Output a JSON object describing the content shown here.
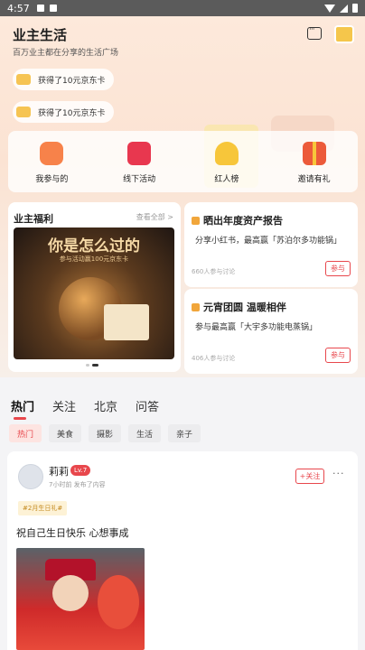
{
  "status": {
    "time": "4:57"
  },
  "header": {
    "title": "业主生活",
    "subtitle": "百万业主都在分享的生活广场"
  },
  "notifications": [
    {
      "text": "获得了10元京东卡"
    },
    {
      "text": "获得了10元京东卡"
    }
  ],
  "categories": [
    {
      "label": "我参与的",
      "icon": "chat-bubble-icon"
    },
    {
      "label": "线下活动",
      "icon": "flag-icon"
    },
    {
      "label": "红人榜",
      "icon": "crown-icon"
    },
    {
      "label": "邀请有礼",
      "icon": "gift-icon"
    }
  ],
  "welfare": {
    "title": "业主福利",
    "more": "查看全部 >",
    "banner_title": "你是怎么过的",
    "banner_sub": "参与活动赢100元京东卡"
  },
  "activities": [
    {
      "title": "晒出年度资产报告",
      "desc": "分享小红书，最高赢「苏泊尔多功能锅」",
      "count": "660人参与讨论",
      "btn": "参与"
    },
    {
      "title": "元宵团圆 温暖相伴",
      "desc": "参与最高赢「大宇多功能电蒸锅」",
      "count": "406人参与讨论",
      "btn": "参与"
    }
  ],
  "tabs": [
    "热门",
    "关注",
    "北京",
    "问答"
  ],
  "chips": [
    "热门",
    "美食",
    "摄影",
    "生活",
    "亲子"
  ],
  "post": {
    "name": "莉莉",
    "level": "Lv.7",
    "time": "7小时前 发布了内容",
    "follow": "+关注",
    "more": "···",
    "tag": "#2月生日礼#",
    "text": "祝自己生日快乐 心想事成"
  },
  "colors": {
    "accent": "#e8474c",
    "gold": "#f6c453"
  }
}
